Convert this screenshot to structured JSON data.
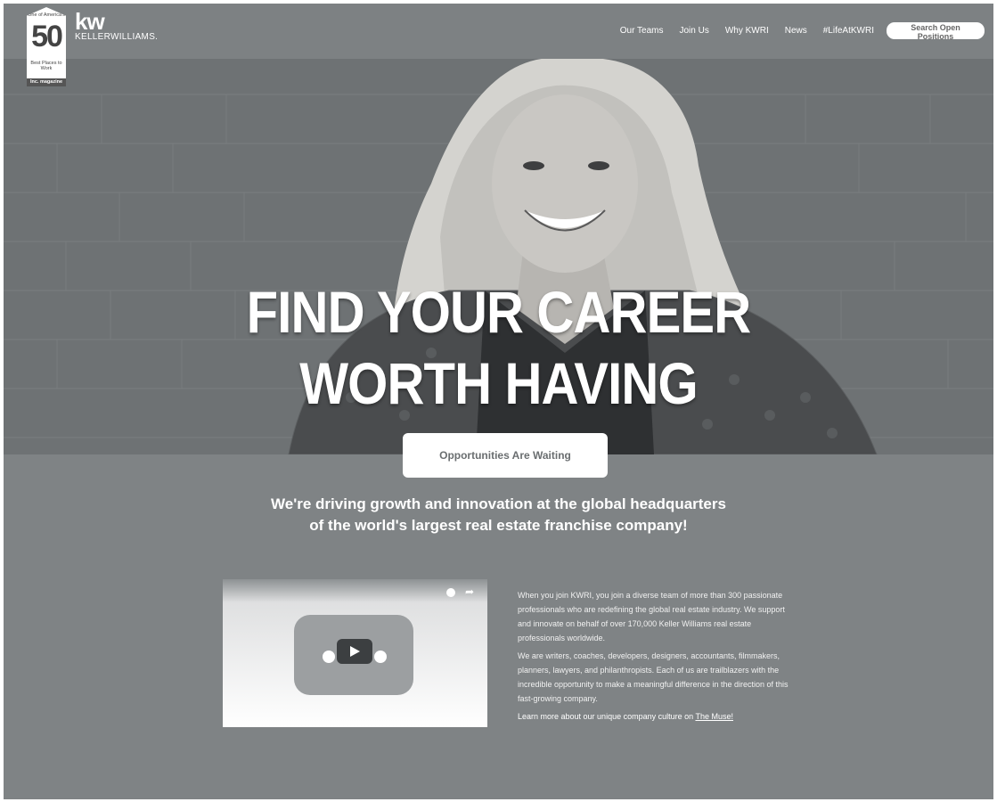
{
  "badge": {
    "top": "One of America's",
    "number": "50",
    "subtitle": "Best Places to Work",
    "footer": "Inc. magazine"
  },
  "logo": {
    "mark": "kw",
    "wordmark": "KELLERWILLIAMS."
  },
  "nav": {
    "items": [
      "Our Teams",
      "Join Us",
      "Why KWRI",
      "News",
      "#LifeAtKWRI"
    ],
    "search_label": "Search Open Positions"
  },
  "hero": {
    "title_line1": "FIND YOUR CAREER",
    "title_line2": "WORTH HAVING",
    "cta_label": "Opportunities Are Waiting"
  },
  "tagline": {
    "line1": "We're driving growth and innovation at the global headquarters",
    "line2": "of the world's largest real estate franchise company!"
  },
  "video": {
    "icons": [
      "clock-icon",
      "share-icon",
      "play-icon"
    ]
  },
  "copy": {
    "paragraph1": "When you join KWRI, you join a diverse team of more than 300 passionate professionals who are redefining the global real estate industry. We support and innovate on behalf of over 170,000 Keller Williams real estate professionals worldwide.",
    "paragraph2": "We are writers, coaches, developers, designers, accountants, filmmakers, planners, lawyers, and philanthropists. Each of us are trailblazers with the incredible opportunity to make a meaningful difference in the direction of this fast-growing company.",
    "learn_prefix": "Learn more about our unique company culture on ",
    "learn_link": "The Muse!"
  },
  "colors": {
    "background": "#7f8385",
    "header": "#7d8183",
    "button": "#ffffff"
  }
}
